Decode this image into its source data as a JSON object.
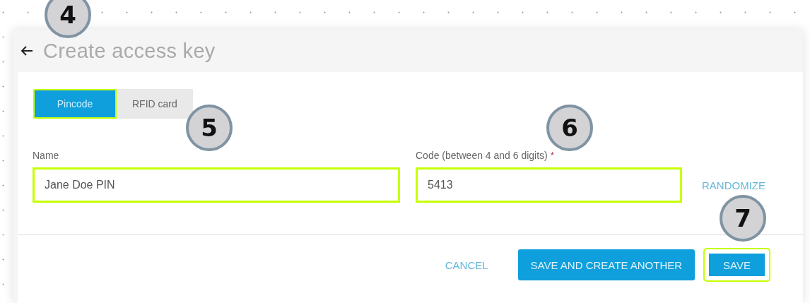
{
  "header": {
    "title": "Create access key"
  },
  "tabs": [
    {
      "label": "Pincode",
      "selected": true,
      "highlighted": true
    },
    {
      "label": "RFID card",
      "selected": false,
      "highlighted": false
    }
  ],
  "fields": [
    {
      "label": "Name",
      "value": "Jane Doe PIN",
      "highlighted": true
    },
    {
      "label": "Code (between 4 and 6 digits)",
      "required_mark": "*",
      "value": "5413",
      "highlighted": true,
      "action": "RANDOMIZE"
    }
  ],
  "buttons": [
    {
      "label": "CANCEL",
      "kind": "text",
      "highlighted": false
    },
    {
      "label": "SAVE AND CREATE ANOTHER",
      "kind": "primary",
      "highlighted": false
    },
    {
      "label": "SAVE",
      "kind": "primary",
      "highlighted": true
    }
  ],
  "callouts": [
    {
      "label": "4"
    },
    {
      "label": "5"
    },
    {
      "label": "6"
    },
    {
      "label": "7"
    }
  ]
}
